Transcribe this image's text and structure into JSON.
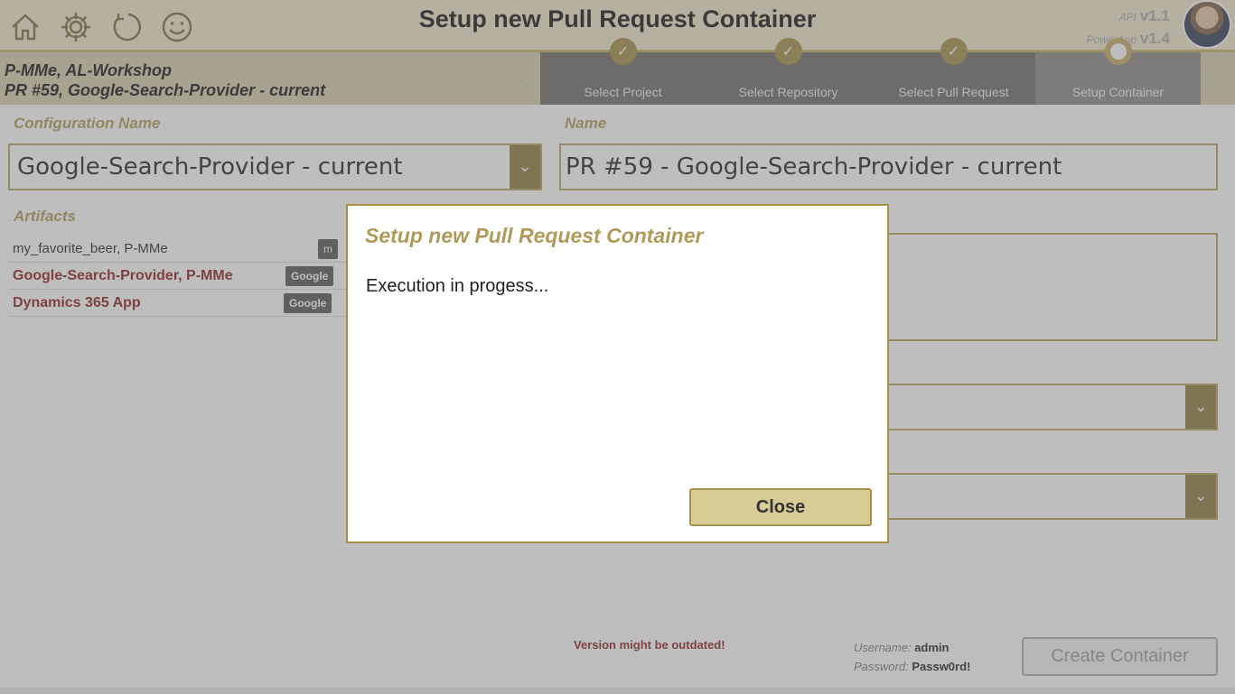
{
  "app": {
    "title": "Setup new Pull Request Container",
    "api_label": "API",
    "api_version": "v1.1",
    "powerapp_label": "PowerApp",
    "powerapp_version": "v1.4"
  },
  "toolbar": {
    "icons": [
      "home-icon",
      "gear-icon",
      "refresh-icon",
      "smiley-icon"
    ]
  },
  "context": {
    "line1": "P-MMe, AL-Workshop",
    "line2": "PR #59, Google-Search-Provider - current"
  },
  "steps": [
    {
      "label": "Select Project",
      "state": "done"
    },
    {
      "label": "Select Repository",
      "state": "done"
    },
    {
      "label": "Select Pull Request",
      "state": "done"
    },
    {
      "label": "Setup Container",
      "state": "active"
    }
  ],
  "form": {
    "config_label": "Configuration Name",
    "config_value": "Google-Search-Provider - current",
    "name_label": "Name",
    "name_value": "PR #59 - Google-Search-Provider - current",
    "artifacts_label": "Artifacts",
    "artifacts": [
      {
        "name": "my_favorite_beer, P-MMe",
        "chip": "m"
      },
      {
        "name": "Google-Search-Provider, P-MMe",
        "chip": "Google"
      },
      {
        "name": "Dynamics 365 App",
        "chip": "Google"
      }
    ]
  },
  "footer": {
    "warning": "Version might be outdated!",
    "username_label": "Username:",
    "username": "admin",
    "password_label": "Password:",
    "password": "Passw0rd!",
    "create_button": "Create Container"
  },
  "dialog": {
    "title": "Setup new Pull Request Container",
    "message": "Execution in progess...",
    "close_button": "Close"
  },
  "colors": {
    "accent": "#b09a58",
    "topbar": "#efe6c9",
    "dropdown": "#8c7a3c",
    "warning": "#8b1a1a"
  }
}
